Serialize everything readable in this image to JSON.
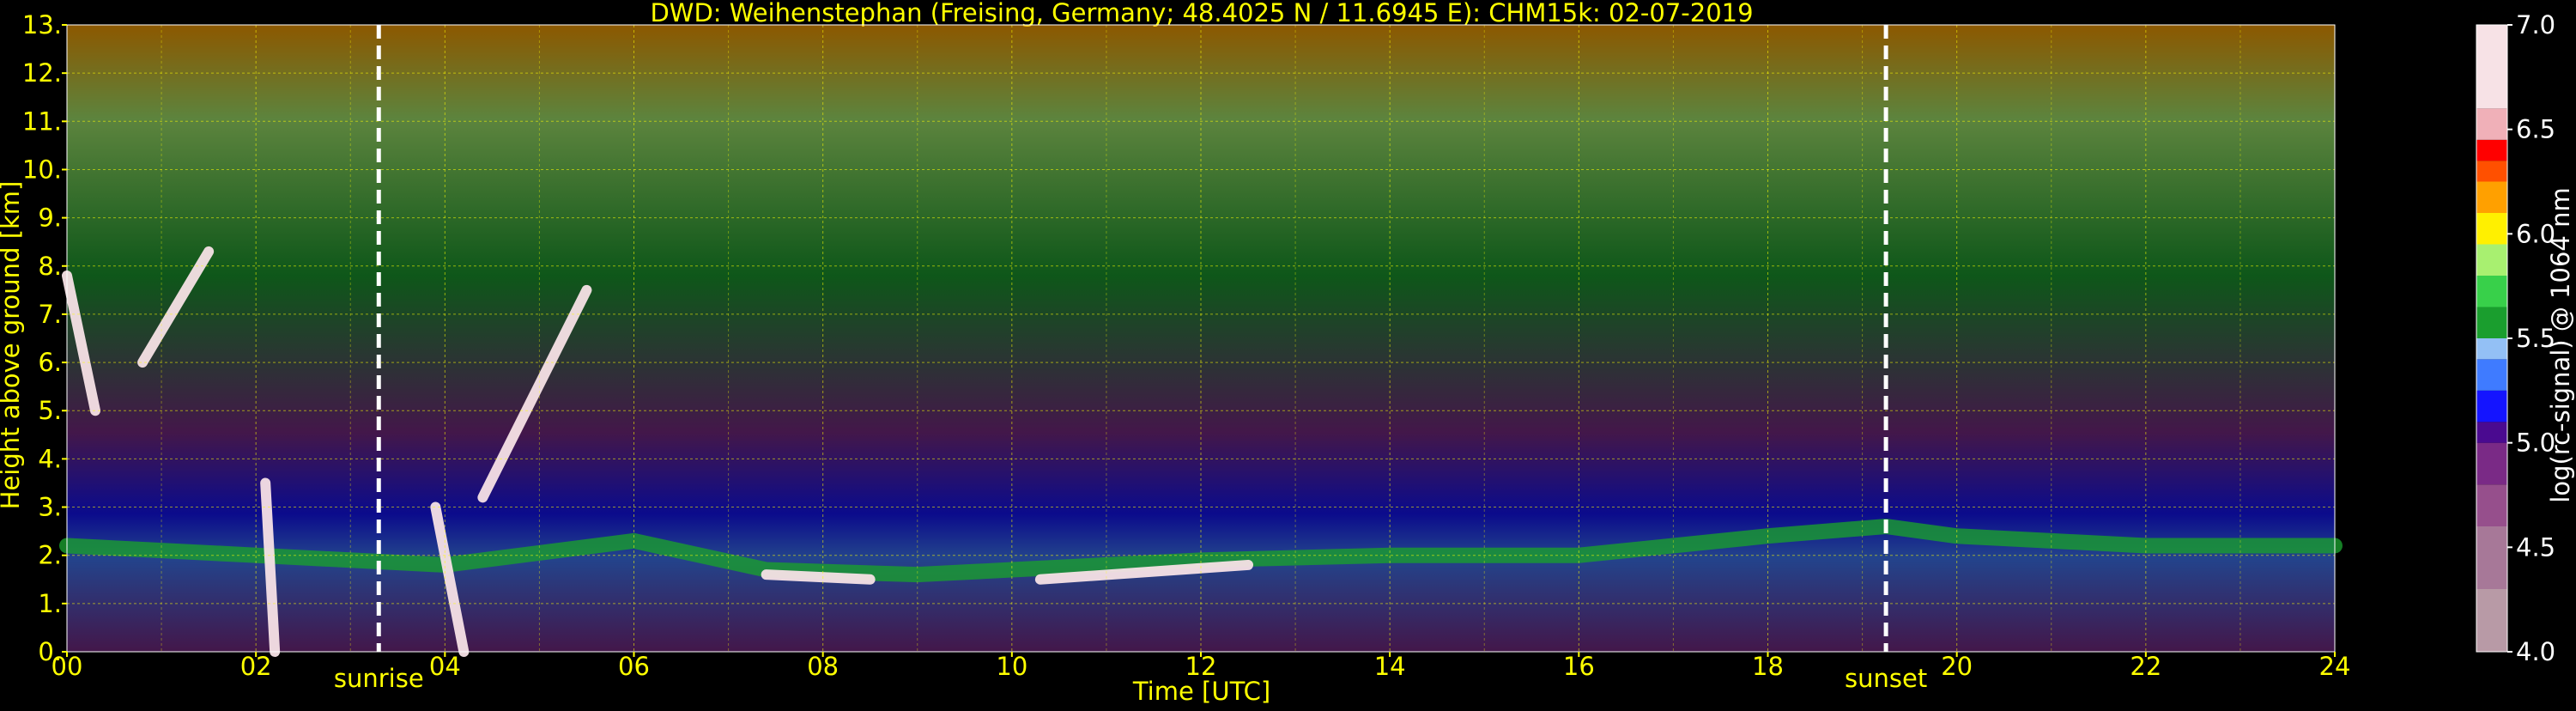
{
  "chart_data": {
    "type": "heatmap",
    "title": "DWD: Weihenstephan (Freising, Germany; 48.4025 N / 11.6945 E):    CHM15k: 02-07-2019",
    "xlabel": "Time [UTC]",
    "ylabel": "Height above ground [km]",
    "xlim": [
      0,
      24
    ],
    "ylim": [
      0,
      13
    ],
    "x_ticks": [
      "00",
      "02",
      "04",
      "06",
      "08",
      "10",
      "12",
      "14",
      "16",
      "18",
      "20",
      "22",
      "24"
    ],
    "y_ticks": [
      "0.",
      "1.",
      "2.",
      "3.",
      "4.",
      "5.",
      "6.",
      "7.",
      "8.",
      "9.",
      "10.",
      "11.",
      "12.",
      "13."
    ],
    "grid": true,
    "markers": [
      {
        "label": "sunrise",
        "x": 3.3
      },
      {
        "label": "sunset",
        "x": 19.25
      }
    ],
    "colorbar": {
      "label": "log(rc-signal) @ 1064 nm",
      "range": [
        4.0,
        7.0
      ],
      "ticks": [
        "4.0",
        "4.5",
        "5.0",
        "5.5",
        "6.0",
        "6.5",
        "7.0"
      ],
      "colors": [
        {
          "value": 4.0,
          "color": "#b89aa6"
        },
        {
          "value": 4.3,
          "color": "#a77898"
        },
        {
          "value": 4.6,
          "color": "#964f8c"
        },
        {
          "value": 4.8,
          "color": "#7a2a86"
        },
        {
          "value": 5.0,
          "color": "#4a0a90"
        },
        {
          "value": 5.1,
          "color": "#1414ff"
        },
        {
          "value": 5.25,
          "color": "#3f7bff"
        },
        {
          "value": 5.4,
          "color": "#93c0f5"
        },
        {
          "value": 5.5,
          "color": "#1a9e2e"
        },
        {
          "value": 5.65,
          "color": "#38d04a"
        },
        {
          "value": 5.8,
          "color": "#a8f070"
        },
        {
          "value": 5.95,
          "color": "#fff000"
        },
        {
          "value": 6.1,
          "color": "#ffa000"
        },
        {
          "value": 6.25,
          "color": "#ff5000"
        },
        {
          "value": 6.35,
          "color": "#ff0000"
        },
        {
          "value": 6.45,
          "color": "#f0b0b8"
        },
        {
          "value": 6.6,
          "color": "#f7e2e6"
        },
        {
          "value": 7.0,
          "color": "#ffffff"
        }
      ]
    },
    "features": [
      {
        "name": "boundary-layer-top",
        "x": [
          0,
          2,
          4,
          6,
          7.4,
          9,
          10,
          12,
          14,
          16,
          18,
          19.25,
          20,
          22,
          24
        ],
        "y": [
          2.2,
          2.0,
          1.8,
          2.3,
          1.7,
          1.6,
          1.7,
          1.9,
          2.0,
          2.0,
          2.4,
          2.6,
          2.4,
          2.2,
          2.2
        ],
        "value": 5.6
      },
      {
        "name": "cloud-streak-1",
        "x": [
          0.0,
          0.3
        ],
        "y": [
          7.8,
          5.0
        ],
        "value": 6.8
      },
      {
        "name": "cloud-streak-2",
        "x": [
          0.8,
          1.5
        ],
        "y": [
          6.0,
          8.3
        ],
        "value": 6.8
      },
      {
        "name": "cloud-streak-3",
        "x": [
          4.4,
          5.5
        ],
        "y": [
          3.2,
          7.5
        ],
        "value": 6.8
      },
      {
        "name": "precip-streak-1",
        "x": [
          2.1,
          2.2
        ],
        "y": [
          3.5,
          0.0
        ],
        "value": 6.9
      },
      {
        "name": "precip-streak-2",
        "x": [
          3.9,
          4.2
        ],
        "y": [
          3.0,
          0.0
        ],
        "value": 6.9
      },
      {
        "name": "cloud-base-1",
        "x": [
          7.4,
          8.5
        ],
        "y": [
          1.6,
          1.5
        ],
        "value": 6.9
      },
      {
        "name": "cloud-base-2",
        "x": [
          10.3,
          12.5
        ],
        "y": [
          1.5,
          1.8
        ],
        "value": 6.9
      }
    ]
  }
}
